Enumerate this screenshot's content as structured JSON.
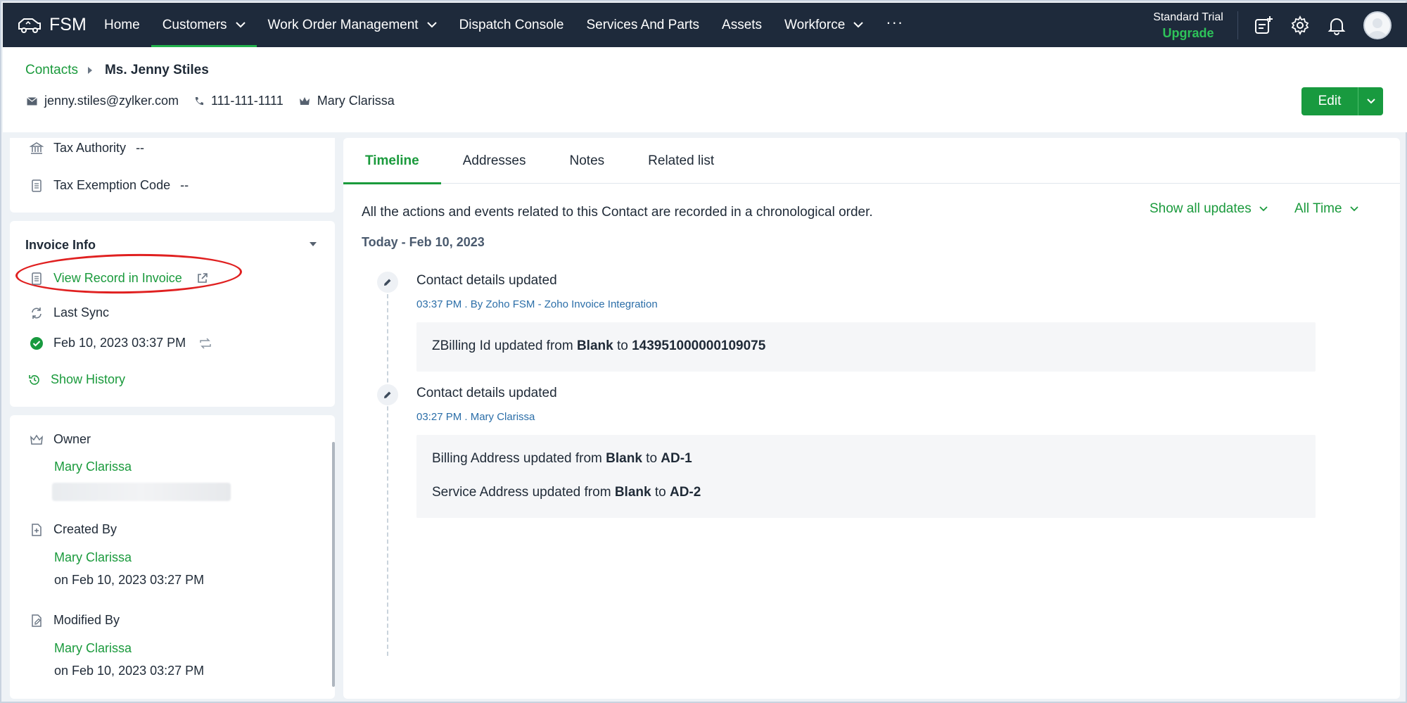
{
  "app": {
    "name": "FSM"
  },
  "nav": {
    "items": [
      {
        "label": "Home"
      },
      {
        "label": "Customers"
      },
      {
        "label": "Work Order Management"
      },
      {
        "label": "Dispatch Console"
      },
      {
        "label": "Services And Parts"
      },
      {
        "label": "Assets"
      },
      {
        "label": "Workforce"
      }
    ],
    "more": "···",
    "trial": "Standard Trial",
    "upgrade": "Upgrade"
  },
  "header": {
    "breadcrumb_parent": "Contacts",
    "record_name": "Ms. Jenny Stiles",
    "email": "jenny.stiles@zylker.com",
    "phone": "111-111-1111",
    "owner": "Mary Clarissa",
    "edit_label": "Edit"
  },
  "tax": {
    "authority_label": "Tax Authority",
    "authority_value": "--",
    "exemption_label": "Tax Exemption Code",
    "exemption_value": "--"
  },
  "invoice": {
    "title": "Invoice Info",
    "view_link": "View Record in Invoice",
    "last_sync_label": "Last Sync",
    "last_sync_value": "Feb 10, 2023 03:37 PM",
    "history_link": "Show History"
  },
  "record_info": {
    "owner_label": "Owner",
    "owner_value": "Mary Clarissa",
    "created_label": "Created By",
    "created_by": "Mary Clarissa",
    "created_on": "on Feb 10, 2023 03:27 PM",
    "modified_label": "Modified By",
    "modified_by": "Mary Clarissa",
    "modified_on": "on Feb 10, 2023 03:27 PM"
  },
  "tabs": [
    {
      "label": "Timeline"
    },
    {
      "label": "Addresses"
    },
    {
      "label": "Notes"
    },
    {
      "label": "Related list"
    }
  ],
  "timeline": {
    "intro": "All the actions and events related to this Contact are recorded in a chronological order.",
    "filter_updates": "Show all updates",
    "filter_time": "All Time",
    "date_group": "Today - Feb 10, 2023",
    "events": [
      {
        "title": "Contact details updated",
        "sub": "03:37 PM . By Zoho FSM - Zoho Invoice Integration",
        "changes": [
          {
            "prefix": "ZBilling Id updated from ",
            "from": "Blank",
            "mid": " to ",
            "to": "143951000000109075"
          }
        ]
      },
      {
        "title": "Contact details updated",
        "sub": "03:27 PM . Mary Clarissa",
        "changes": [
          {
            "prefix": "Billing Address updated from ",
            "from": "Blank",
            "mid": " to ",
            "to": "AD-1"
          },
          {
            "prefix": "Service Address updated from ",
            "from": "Blank",
            "mid": " to ",
            "to": "AD-2"
          }
        ]
      }
    ]
  },
  "colors": {
    "nav_bg": "#1e2a3b",
    "accent": "#1a9a3c",
    "highlight": "#e02020"
  }
}
